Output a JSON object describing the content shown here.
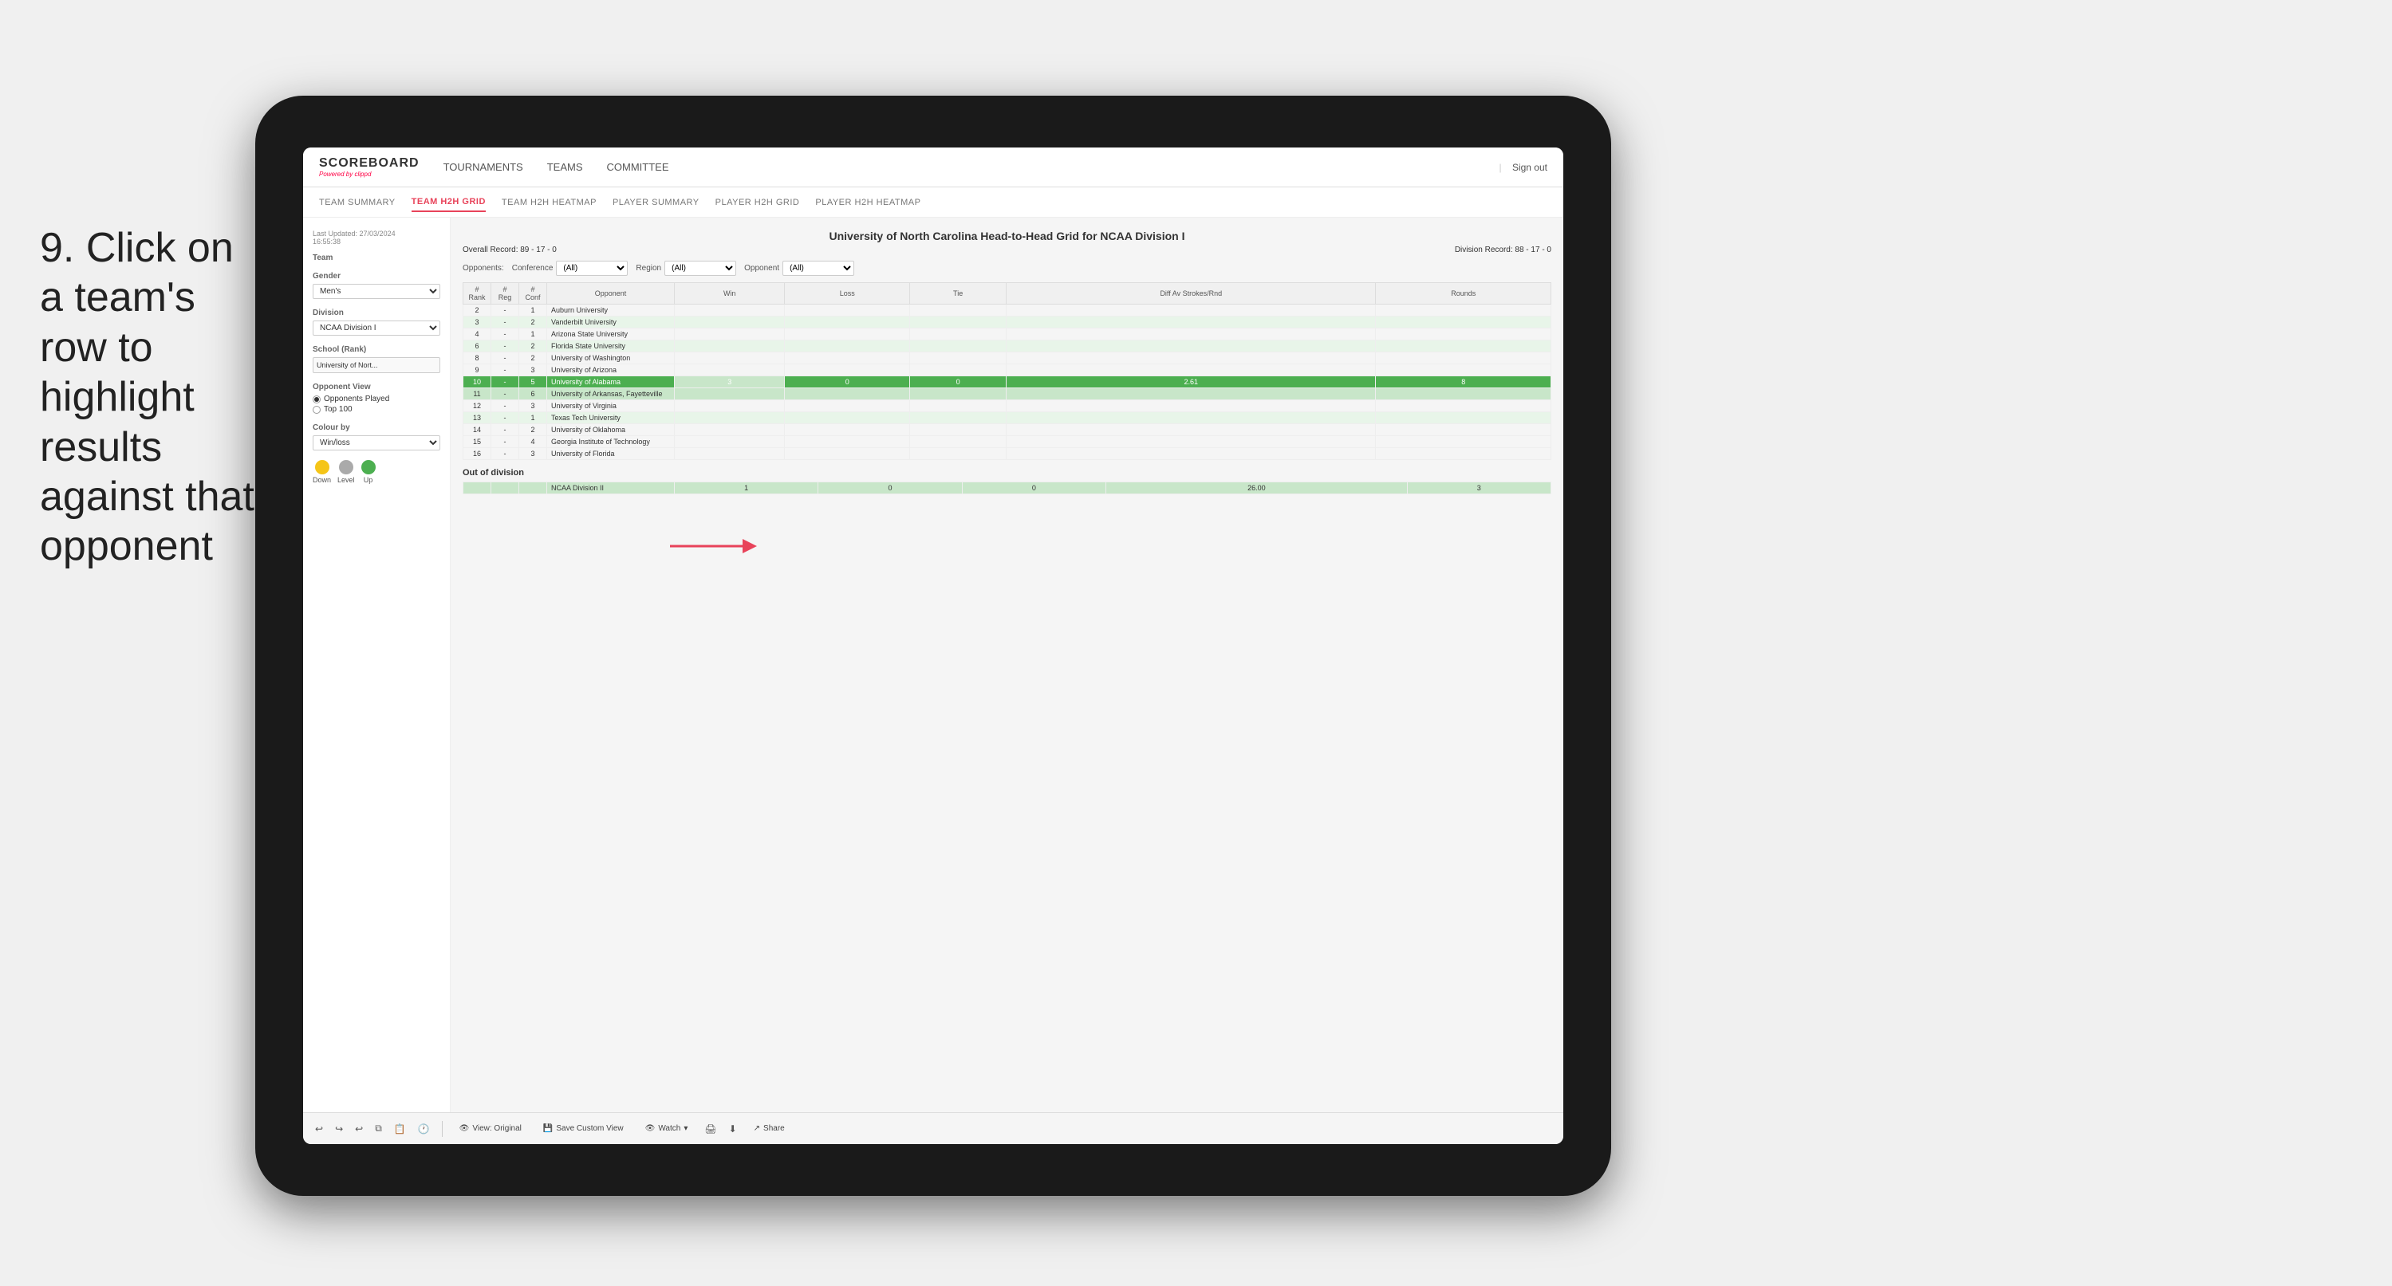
{
  "instruction": {
    "number": "9.",
    "text": "Click on a team's row to highlight results against that opponent"
  },
  "nav": {
    "logo": "SCOREBOARD",
    "powered_by": "Powered by",
    "brand": "clippd",
    "items": [
      "TOURNAMENTS",
      "TEAMS",
      "COMMITTEE"
    ],
    "sign_out": "Sign out"
  },
  "sub_nav": {
    "items": [
      "TEAM SUMMARY",
      "TEAM H2H GRID",
      "TEAM H2H HEATMAP",
      "PLAYER SUMMARY",
      "PLAYER H2H GRID",
      "PLAYER H2H HEATMAP"
    ],
    "active": "TEAM H2H GRID"
  },
  "sidebar": {
    "updated_label": "Last Updated: 27/03/2024",
    "updated_time": "16:55:38",
    "team_label": "Team",
    "gender_label": "Gender",
    "gender_value": "Men's",
    "division_label": "Division",
    "division_value": "NCAA Division I",
    "school_label": "School (Rank)",
    "school_value": "University of Nort...",
    "opponent_view_label": "Opponent View",
    "radio_opponents": "Opponents Played",
    "radio_top100": "Top 100",
    "colour_label": "Colour by",
    "colour_value": "Win/loss",
    "legend": {
      "down_label": "Down",
      "level_label": "Level",
      "up_label": "Up"
    }
  },
  "grid": {
    "title": "University of North Carolina Head-to-Head Grid for NCAA Division I",
    "overall_record": "Overall Record: 89 - 17 - 0",
    "division_record": "Division Record: 88 - 17 - 0",
    "filters": {
      "opponents_label": "Opponents:",
      "conference_label": "Conference",
      "conference_value": "(All)",
      "region_label": "Region",
      "region_value": "(All)",
      "opponent_label": "Opponent",
      "opponent_value": "(All)"
    },
    "columns": [
      "# Rank",
      "# Reg",
      "# Conf",
      "Opponent",
      "Win",
      "Loss",
      "Tie",
      "Diff Av Strokes/Rnd",
      "Rounds"
    ],
    "rows": [
      {
        "rank": "2",
        "reg": "-",
        "conf": "1",
        "opponent": "Auburn University",
        "win": "",
        "loss": "",
        "tie": "",
        "diff": "",
        "rounds": "",
        "style": "normal"
      },
      {
        "rank": "3",
        "reg": "-",
        "conf": "2",
        "opponent": "Vanderbilt University",
        "win": "",
        "loss": "",
        "tie": "",
        "diff": "",
        "rounds": "",
        "style": "light-green"
      },
      {
        "rank": "4",
        "reg": "-",
        "conf": "1",
        "opponent": "Arizona State University",
        "win": "",
        "loss": "",
        "tie": "",
        "diff": "",
        "rounds": "",
        "style": "normal"
      },
      {
        "rank": "6",
        "reg": "-",
        "conf": "2",
        "opponent": "Florida State University",
        "win": "",
        "loss": "",
        "tie": "",
        "diff": "",
        "rounds": "",
        "style": "light-green"
      },
      {
        "rank": "8",
        "reg": "-",
        "conf": "2",
        "opponent": "University of Washington",
        "win": "",
        "loss": "",
        "tie": "",
        "diff": "",
        "rounds": "",
        "style": "normal"
      },
      {
        "rank": "9",
        "reg": "-",
        "conf": "3",
        "opponent": "University of Arizona",
        "win": "",
        "loss": "",
        "tie": "",
        "diff": "",
        "rounds": "",
        "style": "normal"
      },
      {
        "rank": "10",
        "reg": "-",
        "conf": "5",
        "opponent": "University of Alabama",
        "win": "3",
        "loss": "0",
        "tie": "0",
        "diff": "2.61",
        "rounds": "8",
        "style": "highlighted"
      },
      {
        "rank": "11",
        "reg": "-",
        "conf": "6",
        "opponent": "University of Arkansas, Fayetteville",
        "win": "",
        "loss": "",
        "tie": "",
        "diff": "",
        "rounds": "",
        "style": "selected-opponent"
      },
      {
        "rank": "12",
        "reg": "-",
        "conf": "3",
        "opponent": "University of Virginia",
        "win": "",
        "loss": "",
        "tie": "",
        "diff": "",
        "rounds": "",
        "style": "normal"
      },
      {
        "rank": "13",
        "reg": "-",
        "conf": "1",
        "opponent": "Texas Tech University",
        "win": "",
        "loss": "",
        "tie": "",
        "diff": "",
        "rounds": "",
        "style": "light-green"
      },
      {
        "rank": "14",
        "reg": "-",
        "conf": "2",
        "opponent": "University of Oklahoma",
        "win": "",
        "loss": "",
        "tie": "",
        "diff": "",
        "rounds": "",
        "style": "normal"
      },
      {
        "rank": "15",
        "reg": "-",
        "conf": "4",
        "opponent": "Georgia Institute of Technology",
        "win": "",
        "loss": "",
        "tie": "",
        "diff": "",
        "rounds": "",
        "style": "normal"
      },
      {
        "rank": "16",
        "reg": "-",
        "conf": "3",
        "opponent": "University of Florida",
        "win": "",
        "loss": "",
        "tie": "",
        "diff": "",
        "rounds": "",
        "style": "normal"
      }
    ],
    "out_division_label": "Out of division",
    "out_division_row": {
      "division": "NCAA Division II",
      "win": "1",
      "loss": "0",
      "tie": "0",
      "diff": "26.00",
      "rounds": "3"
    }
  },
  "toolbar": {
    "view_label": "View: Original",
    "save_label": "Save Custom View",
    "watch_label": "Watch",
    "share_label": "Share"
  }
}
